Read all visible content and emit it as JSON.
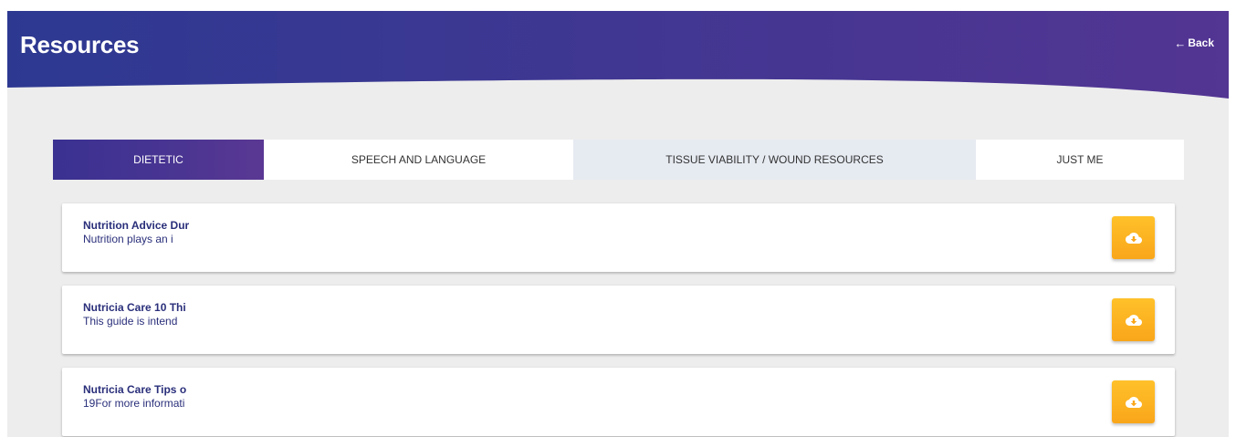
{
  "header": {
    "title": "Resources",
    "back_label": "Back",
    "back_icon": "arrow-left-icon",
    "gradient_start": "#2d3991",
    "gradient_end": "#533593"
  },
  "tabs": [
    {
      "label": "DIETETIC",
      "state": "active"
    },
    {
      "label": "SPEECH AND LANGUAGE",
      "state": "normal"
    },
    {
      "label": "TISSUE VIABILITY / WOUND RESOURCES",
      "state": "hover"
    },
    {
      "label": "JUST ME",
      "state": "normal"
    }
  ],
  "resources": [
    {
      "title": "Nutrition Advice Dur",
      "description": "Nutrition plays an i",
      "action_icon": "cloud-download-icon"
    },
    {
      "title": "Nutricia Care 10 Thi",
      "description": "This guide is intend",
      "action_icon": "cloud-download-icon"
    },
    {
      "title": "Nutricia Care Tips o",
      "description": "19For more informati",
      "action_icon": "cloud-download-icon"
    }
  ],
  "colors": {
    "accent": "#f9a61a",
    "text_primary": "#2a2f7a",
    "background": "#ededed"
  }
}
